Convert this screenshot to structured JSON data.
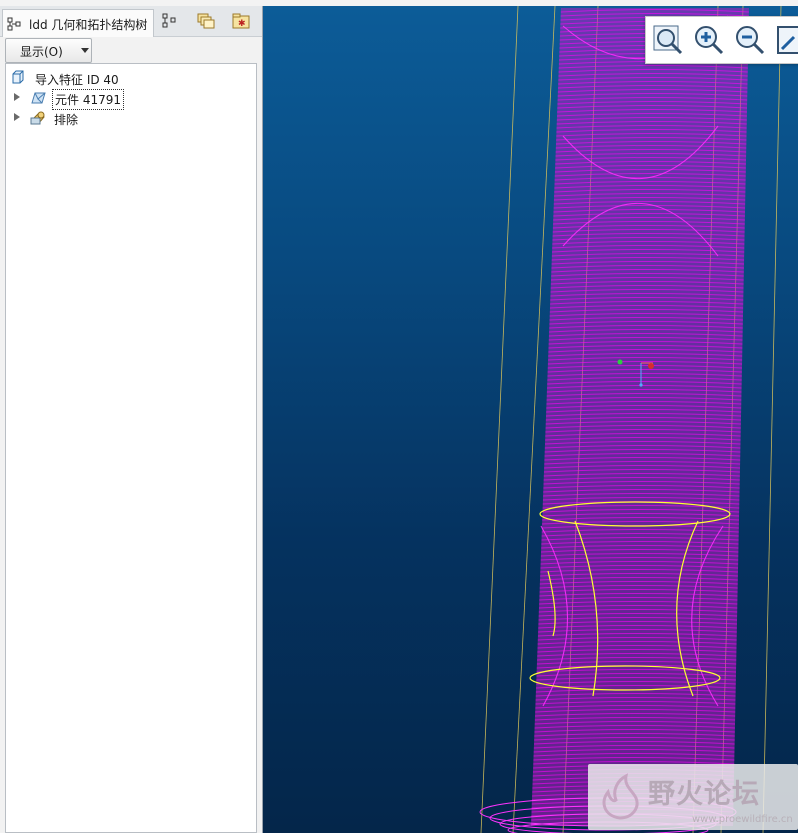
{
  "tabs": {
    "active_label": "ldd 几何和拓扑结构树"
  },
  "show_button": {
    "label": "显示(O)"
  },
  "tree": {
    "root": "导入特征 ID 40",
    "items": [
      {
        "label": "元件 41791"
      },
      {
        "label": "排除"
      }
    ]
  },
  "zoom_toolbar": {
    "icons": [
      "zoom-fit-icon",
      "zoom-in-icon",
      "zoom-out-icon",
      "refit-icon"
    ]
  },
  "watermark": {
    "text": "野火论坛",
    "sub": "www.proewildfire.cn"
  },
  "colors": {
    "viewport_top": "#0c5c98",
    "viewport_bottom": "#04264a",
    "wireframe": "#ff00ff",
    "edge_yellow": "#ffff33"
  }
}
